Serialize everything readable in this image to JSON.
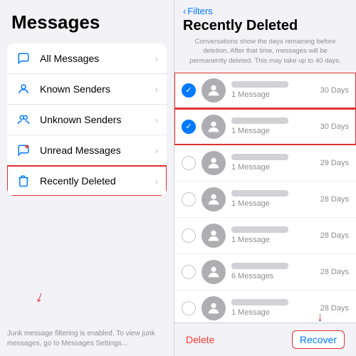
{
  "left": {
    "title": "Messages",
    "menu": [
      {
        "icon": "💬",
        "label": "All Messages",
        "highlighted": false
      },
      {
        "icon": "👤",
        "label": "Known Senders",
        "highlighted": false
      },
      {
        "icon": "👥",
        "label": "Unknown Senders",
        "highlighted": false
      },
      {
        "icon": "💬",
        "label": "Unread Messages",
        "highlighted": false
      },
      {
        "icon": "🗑️",
        "label": "Recently Deleted",
        "highlighted": true
      }
    ],
    "footer": "Junk message filtering is enabled.\nTo view junk messages, go to Messages Settings..."
  },
  "right": {
    "back_label": "Filters",
    "title": "Recently Deleted",
    "subtitle": "Conversations show the days remaining before deletion. After that time, messages will be permanently deleted. This may take up to 40 days.",
    "messages": [
      {
        "selected": true,
        "days": "30 Days",
        "count": "1 Message"
      },
      {
        "selected": true,
        "days": "30 Days",
        "count": "1 Message"
      },
      {
        "selected": false,
        "days": "29 Days",
        "count": "1 Message"
      },
      {
        "selected": false,
        "days": "28 Days",
        "count": "1 Message"
      },
      {
        "selected": false,
        "days": "28 Days",
        "count": "1 Message"
      },
      {
        "selected": false,
        "days": "28 Days",
        "count": "6 Messages"
      },
      {
        "selected": false,
        "days": "28 Days",
        "count": "1 Message"
      }
    ],
    "delete_label": "Delete",
    "recover_label": "Recover"
  }
}
